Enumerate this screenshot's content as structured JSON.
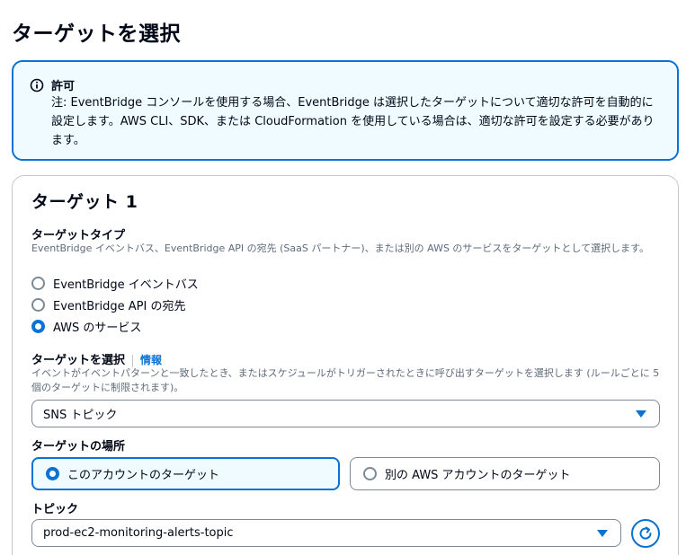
{
  "page": {
    "title": "ターゲットを選択"
  },
  "info": {
    "title": "許可",
    "text": "注: EventBridge コンソールを使用する場合、EventBridge は選択したターゲットについて適切な許可を自動的に設定します。AWS CLI、SDK、または CloudFormation を使用している場合は、適切な許可を設定する必要があります。"
  },
  "target": {
    "card_title": "ターゲット 1",
    "type_label": "ターゲットタイプ",
    "type_desc": "EventBridge イベントバス、EventBridge API の宛先 (SaaS パートナー)、または別の AWS のサービスをターゲットとして選択します。",
    "type_options": [
      {
        "label": "EventBridge イベントバス",
        "selected": false
      },
      {
        "label": "EventBridge API の宛先",
        "selected": false
      },
      {
        "label": "AWS のサービス",
        "selected": true
      }
    ],
    "select_label": "ターゲットを選択",
    "select_info_link": "情報",
    "select_desc": "イベントがイベントパターンと一致したとき、またはスケジュールがトリガーされたときに呼び出すターゲットを選択します (ルールごとに 5 個のターゲットに制限されます)。",
    "select_value": "SNS トピック",
    "location_label": "ターゲットの場所",
    "location_options": [
      {
        "label": "このアカウントのターゲット",
        "selected": true
      },
      {
        "label": "別の AWS アカウントのターゲット",
        "selected": false
      }
    ],
    "topic_label": "トピック",
    "topic_value": "prod-ec2-monitoring-alerts-topic"
  },
  "colors": {
    "accent": "#0972d3",
    "info_bg": "#f0fbff",
    "text": "#000716",
    "muted": "#5f6b7a"
  },
  "icons": {
    "info": "info-circle-icon",
    "refresh": "refresh-icon",
    "caret": "caret-down-icon"
  }
}
